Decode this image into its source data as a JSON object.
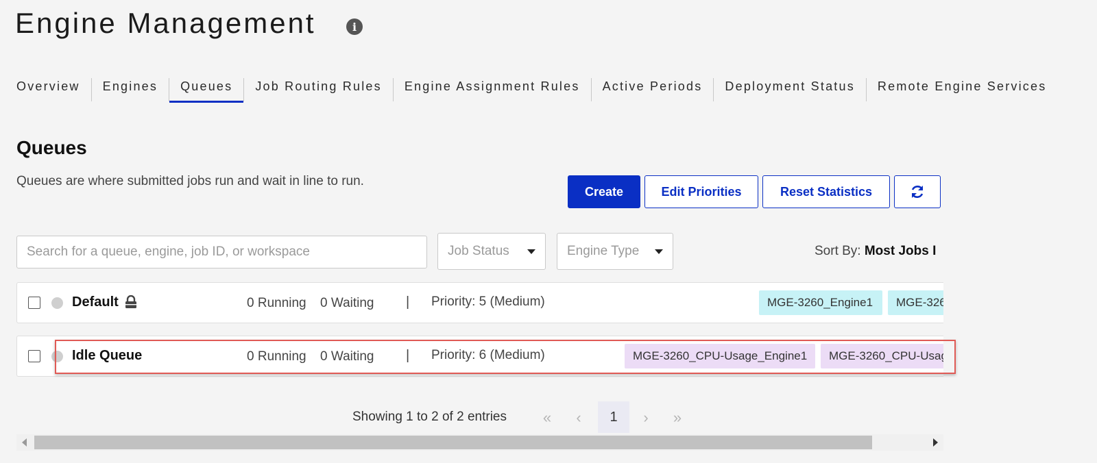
{
  "header": {
    "title": "Engine Management",
    "info_icon": "info-icon"
  },
  "tabs": [
    {
      "label": "Overview",
      "active": false
    },
    {
      "label": "Engines",
      "active": false
    },
    {
      "label": "Queues",
      "active": true
    },
    {
      "label": "Job Routing Rules",
      "active": false
    },
    {
      "label": "Engine Assignment Rules",
      "active": false
    },
    {
      "label": "Active Periods",
      "active": false
    },
    {
      "label": "Deployment Status",
      "active": false
    },
    {
      "label": "Remote Engine Services",
      "active": false
    }
  ],
  "section": {
    "title": "Queues",
    "description": "Queues are where submitted jobs run and wait in line to run."
  },
  "actions": {
    "create": "Create",
    "edit_priorities": "Edit Priorities",
    "reset_statistics": "Reset Statistics",
    "refresh_icon": "refresh-icon"
  },
  "filters": {
    "search_placeholder": "Search for a queue, engine, job ID, or workspace",
    "job_status": "Job Status",
    "engine_type": "Engine Type",
    "sort_label": "Sort By:",
    "sort_value": "Most Jobs I"
  },
  "queues": [
    {
      "name": "Default",
      "locked": true,
      "running": "0 Running",
      "waiting": "0 Waiting",
      "separator": "|",
      "priority": "Priority: 5 (Medium)",
      "engines": [
        "MGE-3260_Engine1",
        "MGE-326"
      ]
    },
    {
      "name": "Idle Queue",
      "locked": false,
      "running": "0 Running",
      "waiting": "0 Waiting",
      "separator": "|",
      "priority": "Priority: 6 (Medium)",
      "engines": [
        "MGE-3260_CPU-Usage_Engine1",
        "MGE-3260_CPU-Usag"
      ]
    }
  ],
  "pagination": {
    "summary": "Showing 1 to 2 of 2 entries",
    "first": "«",
    "prev": "‹",
    "current": "1",
    "next": "›",
    "last": "»"
  },
  "colors": {
    "primary": "#0a2fc4",
    "chip_cyan": "#c7f2f6",
    "chip_purple": "#ecdcf6",
    "highlight": "#e05a55"
  }
}
